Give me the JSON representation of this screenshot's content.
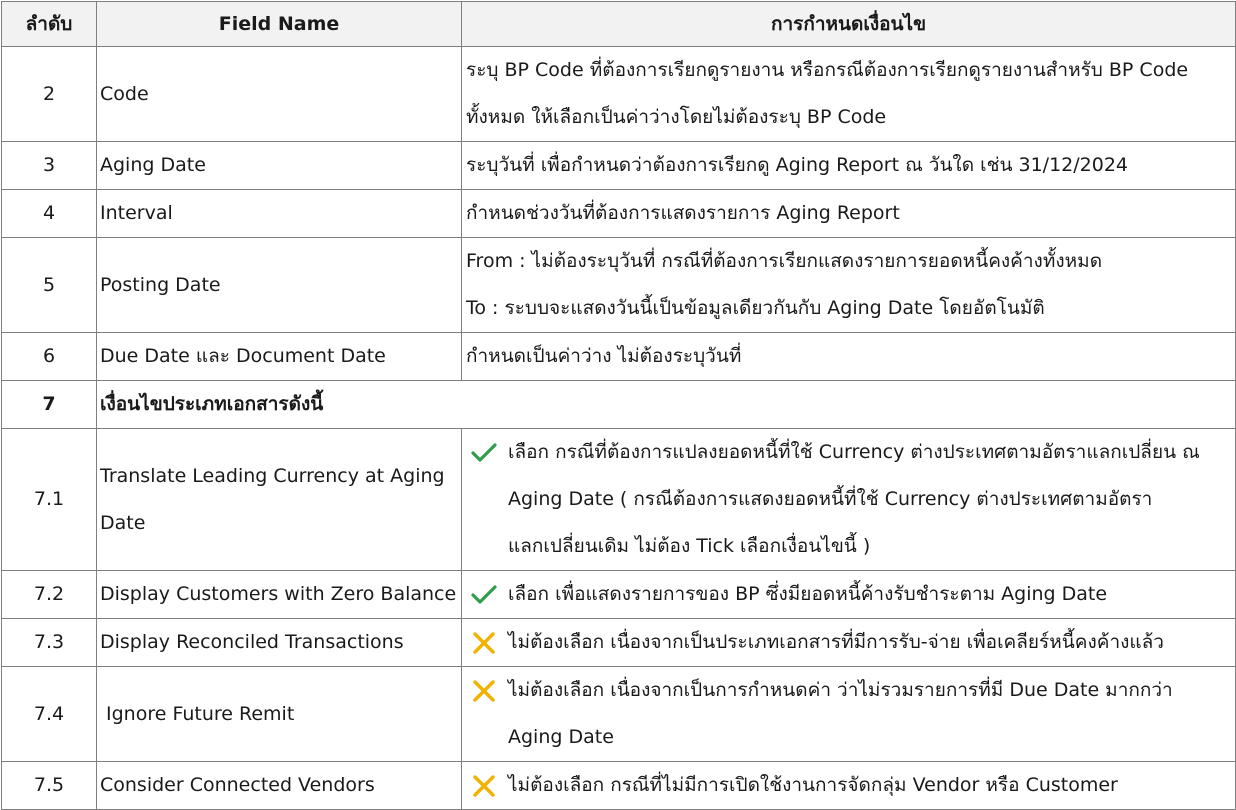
{
  "table": {
    "headers": {
      "order": "ลำดับ",
      "field_name": "Field Name",
      "condition": "การกำหนดเงื่อนไข"
    },
    "rows": [
      {
        "no": "2",
        "field": "Code",
        "desc_lines": [
          "ระบุ BP Code ที่ต้องการเรียกดูรายงาน หรือกรณีต้องการเรียกดูรายงานสำหรับ BP Code",
          "ทั้งหมด ให้เลือกเป็นค่าว่างโดยไม่ต้องระบุ BP Code"
        ]
      },
      {
        "no": "3",
        "field": "Aging Date",
        "desc_lines": [
          "ระบุวันที่ เพื่อกำหนดว่าต้องการเรียกดู Aging Report ณ วันใด เช่น 31/12/2024"
        ]
      },
      {
        "no": "4",
        "field": "Interval",
        "desc_lines": [
          "กำหนดช่วงวันที่ต้องการแสดงรายการ Aging Report"
        ]
      },
      {
        "no": "5",
        "field": "Posting Date",
        "desc_lines": [
          "From : ไม่ต้องระบุวันที่ กรณีที่ต้องการเรียกแสดงรายการยอดหนี้คงค้างทั้งหมด",
          "To : ระบบจะแสดงวันนี้เป็นข้อมูลเดียวกันกับ Aging Date โดยอัตโนมัติ"
        ]
      },
      {
        "no": "6",
        "field": "Due Date และ Document Date",
        "desc_lines": [
          "กำหนดเป็นค่าว่าง ไม่ต้องระบุวันที่"
        ]
      }
    ],
    "section": {
      "no": "7",
      "title": "เงื่อนไขประเภทเอกสารดังนี้"
    },
    "options": [
      {
        "no": "7.1",
        "field_lines": [
          "Translate Leading Currency at Aging",
          "Date"
        ],
        "mark": "check-icon",
        "desc_lines": [
          "เลือก กรณีที่ต้องการแปลงยอดหนี้ที่ใช้ Currency ต่างประเทศตามอัตราแลกเปลี่ยน ณ",
          " Aging Date ( กรณีต้องการแสดงยอดหนี้ที่ใช้ Currency ต่างประเทศตามอัตรา",
          "แลกเปลี่ยนเดิม ไม่ต้อง Tick เลือกเงื่อนไขนี้ )"
        ]
      },
      {
        "no": "7.2",
        "field_lines": [
          "Display Customers with Zero Balance"
        ],
        "mark": "check-icon",
        "desc_lines": [
          "เลือก เพื่อแสดงรายการของ BP ซึ่งมียอดหนี้ค้างรับชำระตาม Aging Date"
        ]
      },
      {
        "no": "7.3",
        "field_lines": [
          "Display Reconciled Transactions"
        ],
        "mark": "cross-icon",
        "desc_lines": [
          "ไม่ต้องเลือก เนื่องจากเป็นประเภทเอกสารที่มีการรับ-จ่าย เพื่อเคลียร์หนี้คงค้างแล้ว"
        ]
      },
      {
        "no": "7.4",
        "field_lines": [
          "Ignore Future Remit"
        ],
        "mark": "cross-icon",
        "desc_lines": [
          "ไม่ต้องเลือก เนื่องจากเป็นการกำหนดค่า ว่าไม่รวมรายการที่มี Due Date มากกว่า",
          "Aging Date"
        ]
      },
      {
        "no": "7.5",
        "field_lines": [
          "Consider Connected Vendors"
        ],
        "mark": "cross-icon",
        "desc_lines": [
          "ไม่ต้องเลือก กรณีที่ไม่มีการเปิดใช้งานการจัดกลุ่ม Vendor หรือ Customer"
        ]
      }
    ],
    "colors": {
      "header_bg": "#f2f2f2",
      "border": "#7f7f7f",
      "check": "#2e9e4a",
      "cross": "#f2b200"
    }
  }
}
